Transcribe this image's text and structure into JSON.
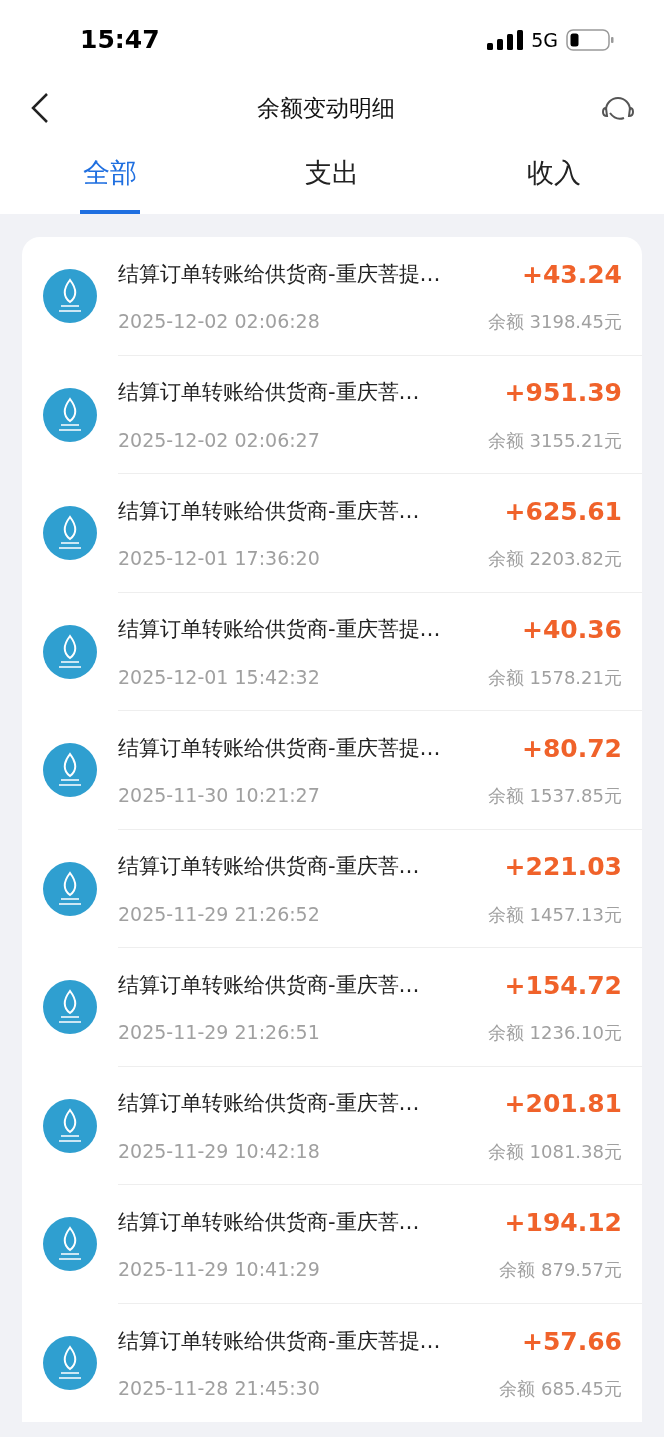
{
  "status_bar": {
    "time": "15:47",
    "network": "5G"
  },
  "header": {
    "title": "余额变动明细"
  },
  "tabs": [
    {
      "label": "全部",
      "selected": true
    },
    {
      "label": "支出",
      "selected": false
    },
    {
      "label": "收入",
      "selected": false
    }
  ],
  "transactions": [
    {
      "title": "结算订单转账给供货商-重庆菩提…",
      "date": "2025-12-02 02:06:28",
      "amount": "+43.24",
      "balance": "余额 3198.45元"
    },
    {
      "title": "结算订单转账给供货商-重庆菩…",
      "date": "2025-12-02 02:06:27",
      "amount": "+951.39",
      "balance": "余额 3155.21元"
    },
    {
      "title": "结算订单转账给供货商-重庆菩…",
      "date": "2025-12-01 17:36:20",
      "amount": "+625.61",
      "balance": "余额 2203.82元"
    },
    {
      "title": "结算订单转账给供货商-重庆菩提…",
      "date": "2025-12-01 15:42:32",
      "amount": "+40.36",
      "balance": "余额 1578.21元"
    },
    {
      "title": "结算订单转账给供货商-重庆菩提…",
      "date": "2025-11-30 10:21:27",
      "amount": "+80.72",
      "balance": "余额 1537.85元"
    },
    {
      "title": "结算订单转账给供货商-重庆菩…",
      "date": "2025-11-29 21:26:52",
      "amount": "+221.03",
      "balance": "余额 1457.13元"
    },
    {
      "title": "结算订单转账给供货商-重庆菩…",
      "date": "2025-11-29 21:26:51",
      "amount": "+154.72",
      "balance": "余额 1236.10元"
    },
    {
      "title": "结算订单转账给供货商-重庆菩…",
      "date": "2025-11-29 10:42:18",
      "amount": "+201.81",
      "balance": "余额 1081.38元"
    },
    {
      "title": "结算订单转账给供货商-重庆菩…",
      "date": "2025-11-29 10:41:29",
      "amount": "+194.12",
      "balance": "余额 879.57元"
    },
    {
      "title": "结算订单转账给供货商-重庆菩提…",
      "date": "2025-11-28 21:45:30",
      "amount": "+57.66",
      "balance": "余额 685.45元"
    }
  ]
}
